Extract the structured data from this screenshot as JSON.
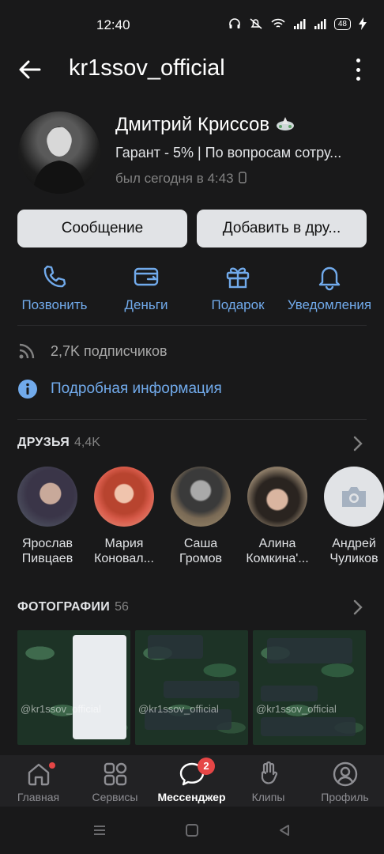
{
  "status_bar": {
    "time": "12:40",
    "battery": "48"
  },
  "header": {
    "title": "kr1ssov_official"
  },
  "profile": {
    "name": "Дмитрий Криссов",
    "status": "Гарант - 5% | По вопросам сотру...",
    "last_seen": "был сегодня в 4:43"
  },
  "buttons": {
    "message": "Сообщение",
    "add_friend": "Добавить в дру..."
  },
  "actions": [
    {
      "label": "Позвонить",
      "icon": "phone-icon"
    },
    {
      "label": "Деньги",
      "icon": "money-transfer-icon"
    },
    {
      "label": "Подарок",
      "icon": "gift-icon"
    },
    {
      "label": "Уведомления",
      "icon": "bell-icon"
    }
  ],
  "subscribers": "2,7K подписчиков",
  "details_link": "Подробная информация",
  "friends": {
    "heading": "ДРУЗЬЯ",
    "count": "4,4K",
    "items": [
      {
        "line1": "Ярослав",
        "line2": "Пивцаев"
      },
      {
        "line1": "Мария",
        "line2": "Коновал..."
      },
      {
        "line1": "Саша",
        "line2": "Громов"
      },
      {
        "line1": "Алина",
        "line2": "Комкина'..."
      },
      {
        "line1": "Андрей",
        "line2": "Чуликов"
      }
    ]
  },
  "photos": {
    "heading": "ФОТОГРАФИИ",
    "count": "56",
    "watermarks": [
      "@kr1ssov_official",
      "@kr1ssov_official",
      "@kr1ssov_official"
    ]
  },
  "bottom_nav": {
    "items": [
      {
        "label": "Главная",
        "icon": "home-icon"
      },
      {
        "label": "Сервисы",
        "icon": "services-grid-icon"
      },
      {
        "label": "Мессенджер",
        "icon": "messenger-icon",
        "badge": "2"
      },
      {
        "label": "Клипы",
        "icon": "clips-icon"
      },
      {
        "label": "Профиль",
        "icon": "profile-icon"
      }
    ]
  },
  "colors": {
    "accent": "#71aaeb",
    "background": "#19191a",
    "badge": "#e64646"
  }
}
